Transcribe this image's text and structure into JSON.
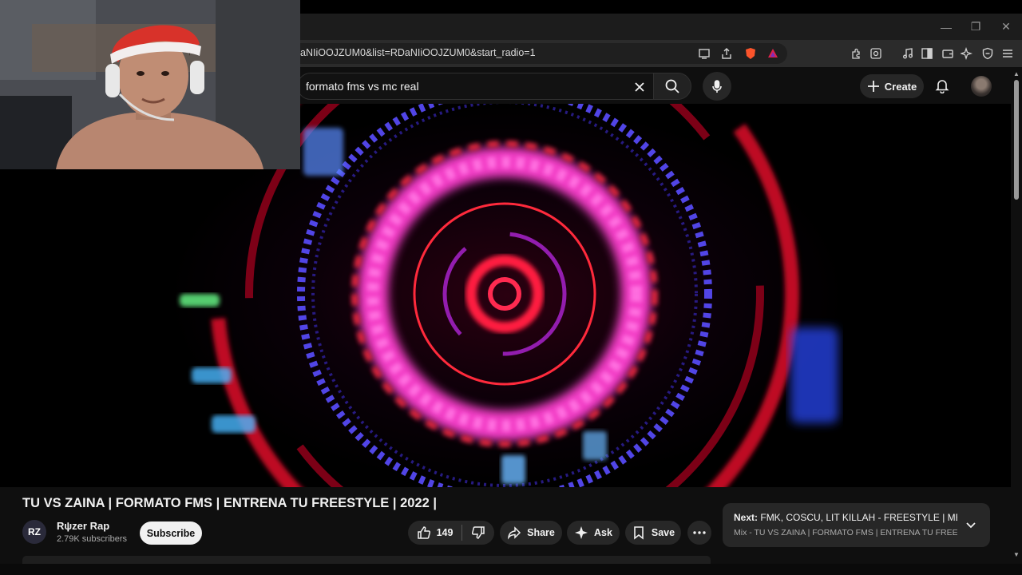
{
  "browser": {
    "url": "aNIiOOJZUM0&list=RDaNIiOOJZUM0&start_radio=1",
    "window_controls": [
      "minimize",
      "restore",
      "close"
    ]
  },
  "masthead": {
    "search_query": "formato fms vs mc real",
    "create_label": "Create"
  },
  "video": {
    "title": "TU VS ZAINA | FORMATO FMS | ENTRENA TU FREESTYLE | 2022 |",
    "channel_initials": "RZ",
    "channel_name": "Rψzer Rap",
    "subscribers": "2.79K subscribers",
    "subscribe_label": "Subscribe",
    "likes": "149",
    "share_label": "Share",
    "ask_label": "Ask",
    "save_label": "Save"
  },
  "next": {
    "label": "Next:",
    "title": "FMK, COSCU, LIT KILLAH - FREESTYLE | MEDI...",
    "subtitle": "Mix - TU VS ZAINA | FORMATO FMS | ENTRENA TU FREESTY..."
  },
  "colors": {
    "bg": "#0f0f0f",
    "pill": "#272727",
    "accent_red": "#ff2a3c",
    "accent_magenta": "#ff3fd0",
    "accent_blue": "#4a5cff"
  }
}
